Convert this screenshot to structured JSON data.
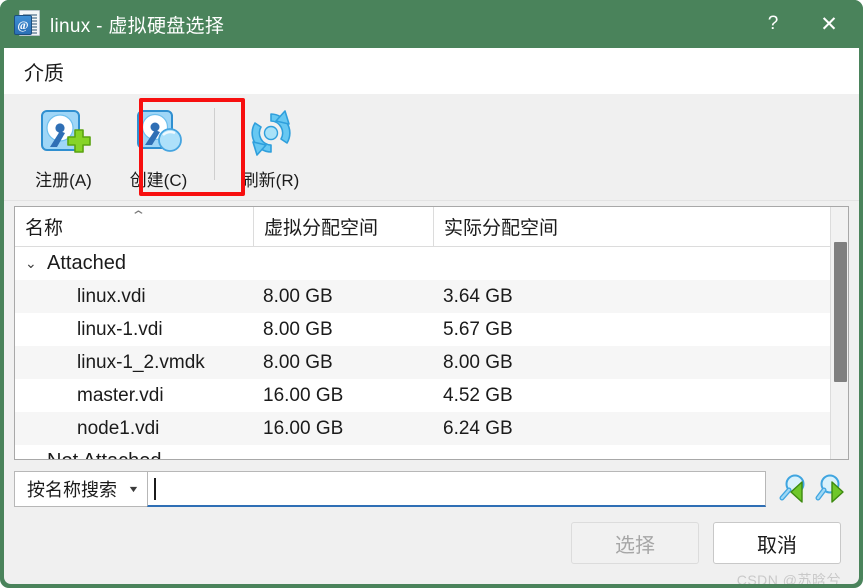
{
  "window": {
    "title": "linux - 虚拟硬盘选择",
    "icon": "virtualbox-medium-icon",
    "help_label": "?",
    "close_label": "✕",
    "titlebar_color": "#4a835b"
  },
  "menubar": {
    "items": [
      {
        "label": "介质",
        "name": "menu-media"
      }
    ]
  },
  "toolbar": {
    "buttons": [
      {
        "label": "注册(A)",
        "icon": "hard-disk-add-icon",
        "name": "register-button"
      },
      {
        "label": "创建(C)",
        "icon": "hard-disk-create-icon",
        "name": "create-button",
        "highlighted": true
      },
      {
        "label": "刷新(R)",
        "icon": "refresh-icon",
        "name": "refresh-button"
      }
    ],
    "annotation_color": "#f70f0f"
  },
  "table": {
    "columns": [
      {
        "label": "名称",
        "sorted": "ascending",
        "sort_glyph": "⌃"
      },
      {
        "label": "虚拟分配空间"
      },
      {
        "label": "实际分配空间"
      }
    ],
    "groups": [
      {
        "label": "Attached",
        "expanded": true,
        "twisty": "⌄",
        "rows": [
          {
            "name": "linux.vdi",
            "virtual": "8.00 GB",
            "actual": "3.64 GB"
          },
          {
            "name": "linux-1.vdi",
            "virtual": "8.00 GB",
            "actual": "5.67 GB"
          },
          {
            "name": "linux-1_2.vmdk",
            "virtual": "8.00 GB",
            "actual": "8.00 GB"
          },
          {
            "name": "master.vdi",
            "virtual": "16.00 GB",
            "actual": "4.52 GB"
          },
          {
            "name": "node1.vdi",
            "virtual": "16.00 GB",
            "actual": "6.24 GB"
          }
        ]
      },
      {
        "label": "Not Attached",
        "expanded": true,
        "twisty": "⌄",
        "rows": []
      }
    ]
  },
  "search": {
    "mode_label": "按名称搜索",
    "mode_caret": "▼",
    "value": "",
    "placeholder": "",
    "prev_icon": "search-previous-icon",
    "next_icon": "search-next-icon"
  },
  "footer": {
    "select_label": "选择",
    "select_enabled": false,
    "cancel_label": "取消",
    "cancel_enabled": true,
    "watermark": "CSDN @苏晗兮"
  }
}
